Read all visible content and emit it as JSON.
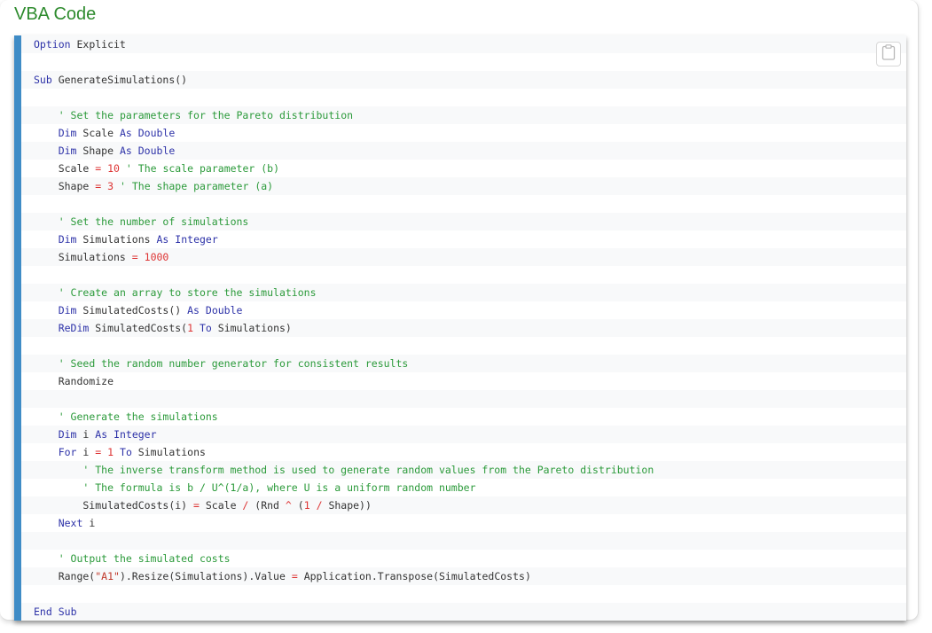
{
  "page": {
    "title": "VBA Code"
  },
  "copy_button": {
    "icon": "clipboard-icon"
  },
  "colors": {
    "title": "#2e8b2e",
    "accent_bar": "#3f8cc6",
    "keyword": "#2d32a8",
    "comment": "#2b9a3a",
    "number": "#dd3333"
  },
  "code": {
    "language": "VBA",
    "lines": [
      [
        [
          "kw",
          "Option"
        ],
        [
          "t",
          " Explicit"
        ]
      ],
      [],
      [
        [
          "kw",
          "Sub"
        ],
        [
          "t",
          " GenerateSimulations()"
        ]
      ],
      [],
      [
        [
          "t",
          "    "
        ],
        [
          "cm",
          "' Set the parameters for the Pareto distribution"
        ]
      ],
      [
        [
          "t",
          "    "
        ],
        [
          "kw",
          "Dim"
        ],
        [
          "t",
          " Scale "
        ],
        [
          "kw",
          "As"
        ],
        [
          "t",
          " "
        ],
        [
          "kw",
          "Double"
        ]
      ],
      [
        [
          "t",
          "    "
        ],
        [
          "kw",
          "Dim"
        ],
        [
          "t",
          " Shape "
        ],
        [
          "kw",
          "As"
        ],
        [
          "t",
          " "
        ],
        [
          "kw",
          "Double"
        ]
      ],
      [
        [
          "t",
          "    Scale "
        ],
        [
          "op",
          "="
        ],
        [
          "t",
          " "
        ],
        [
          "num",
          "10"
        ],
        [
          "t",
          " "
        ],
        [
          "cm",
          "' The scale parameter (b)"
        ]
      ],
      [
        [
          "t",
          "    Shape "
        ],
        [
          "op",
          "="
        ],
        [
          "t",
          " "
        ],
        [
          "num",
          "3"
        ],
        [
          "t",
          " "
        ],
        [
          "cm",
          "' The shape parameter (a)"
        ]
      ],
      [],
      [
        [
          "t",
          "    "
        ],
        [
          "cm",
          "' Set the number of simulations"
        ]
      ],
      [
        [
          "t",
          "    "
        ],
        [
          "kw",
          "Dim"
        ],
        [
          "t",
          " Simulations "
        ],
        [
          "kw",
          "As"
        ],
        [
          "t",
          " "
        ],
        [
          "kw",
          "Integer"
        ]
      ],
      [
        [
          "t",
          "    Simulations "
        ],
        [
          "op",
          "="
        ],
        [
          "t",
          " "
        ],
        [
          "num",
          "1000"
        ]
      ],
      [],
      [
        [
          "t",
          "    "
        ],
        [
          "cm",
          "' Create an array to store the simulations"
        ]
      ],
      [
        [
          "t",
          "    "
        ],
        [
          "kw",
          "Dim"
        ],
        [
          "t",
          " SimulatedCosts() "
        ],
        [
          "kw",
          "As"
        ],
        [
          "t",
          " "
        ],
        [
          "kw",
          "Double"
        ]
      ],
      [
        [
          "t",
          "    "
        ],
        [
          "kw",
          "ReDim"
        ],
        [
          "t",
          " SimulatedCosts("
        ],
        [
          "num",
          "1"
        ],
        [
          "t",
          " "
        ],
        [
          "kw",
          "To"
        ],
        [
          "t",
          " Simulations)"
        ]
      ],
      [],
      [
        [
          "t",
          "    "
        ],
        [
          "cm",
          "' Seed the random number generator for consistent results"
        ]
      ],
      [
        [
          "t",
          "    Randomize"
        ]
      ],
      [],
      [
        [
          "t",
          "    "
        ],
        [
          "cm",
          "' Generate the simulations"
        ]
      ],
      [
        [
          "t",
          "    "
        ],
        [
          "kw",
          "Dim"
        ],
        [
          "t",
          " i "
        ],
        [
          "kw",
          "As"
        ],
        [
          "t",
          " "
        ],
        [
          "kw",
          "Integer"
        ]
      ],
      [
        [
          "t",
          "    "
        ],
        [
          "kw",
          "For"
        ],
        [
          "t",
          " i "
        ],
        [
          "op",
          "="
        ],
        [
          "t",
          " "
        ],
        [
          "num",
          "1"
        ],
        [
          "t",
          " "
        ],
        [
          "kw",
          "To"
        ],
        [
          "t",
          " Simulations"
        ]
      ],
      [
        [
          "t",
          "        "
        ],
        [
          "cm",
          "' The inverse transform method is used to generate random values from the Pareto distribution"
        ]
      ],
      [
        [
          "t",
          "        "
        ],
        [
          "cm",
          "' The formula is b / U^(1/a), where U is a uniform random number"
        ]
      ],
      [
        [
          "t",
          "        SimulatedCosts(i) "
        ],
        [
          "op",
          "="
        ],
        [
          "t",
          " Scale "
        ],
        [
          "op",
          "/"
        ],
        [
          "t",
          " (Rnd "
        ],
        [
          "op",
          "^"
        ],
        [
          "t",
          " ("
        ],
        [
          "num",
          "1"
        ],
        [
          "t",
          " "
        ],
        [
          "op",
          "/"
        ],
        [
          "t",
          " Shape))"
        ]
      ],
      [
        [
          "t",
          "    "
        ],
        [
          "kw",
          "Next"
        ],
        [
          "t",
          " i"
        ]
      ],
      [],
      [
        [
          "t",
          "    "
        ],
        [
          "cm",
          "' Output the simulated costs"
        ]
      ],
      [
        [
          "t",
          "    Range("
        ],
        [
          "str",
          "\"A1\""
        ],
        [
          "t",
          ").Resize(Simulations).Value "
        ],
        [
          "op",
          "="
        ],
        [
          "t",
          " Application.Transpose(SimulatedCosts)"
        ]
      ],
      [],
      [
        [
          "kw",
          "End"
        ],
        [
          "t",
          " "
        ],
        [
          "kw",
          "Sub"
        ]
      ]
    ]
  }
}
